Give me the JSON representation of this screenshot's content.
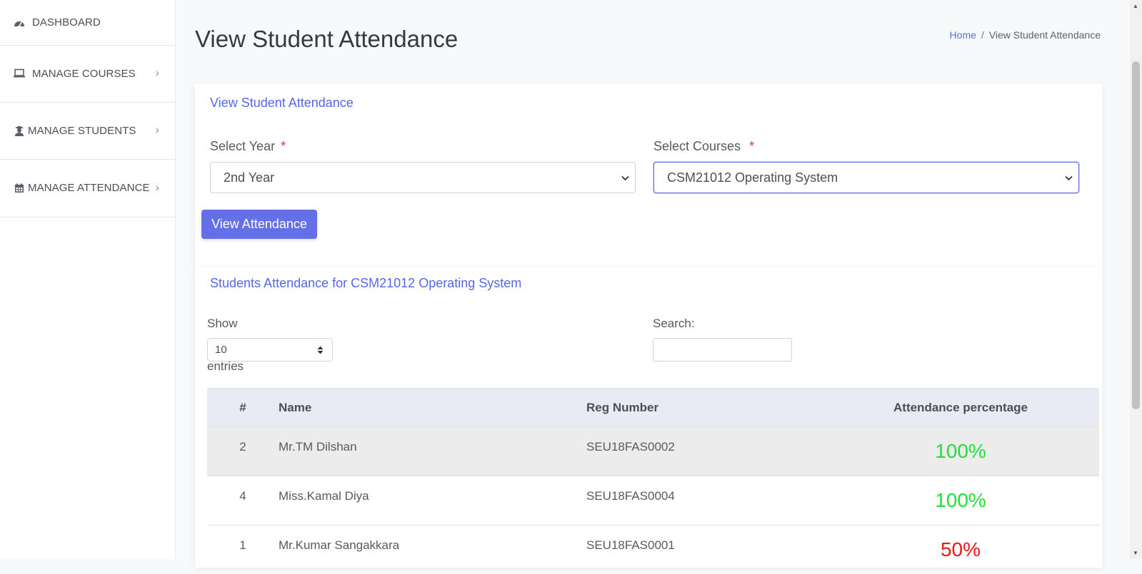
{
  "sidebar": {
    "items": [
      {
        "label": "DASHBOARD",
        "icon": "dashboard-icon",
        "has_chevron": false
      },
      {
        "label": "MANAGE COURSES",
        "icon": "laptop-icon",
        "has_chevron": true
      },
      {
        "label": "MANAGE STUDENTS",
        "icon": "student-icon",
        "has_chevron": true
      },
      {
        "label": "MANAGE ATTENDANCE",
        "icon": "calendar-icon",
        "has_chevron": true
      }
    ],
    "chevron": "›"
  },
  "page": {
    "title": "View Student Attendance",
    "breadcrumb": {
      "home": "Home",
      "separator": "/",
      "current": "View Student Attendance"
    }
  },
  "filter_card": {
    "title": "View Student Attendance",
    "year_label": "Select Year",
    "year_value": "2nd Year",
    "courses_label": "Select Courses",
    "courses_value": "CSM21012 Operating System",
    "required_mark": "*",
    "button_label": "View Attendance"
  },
  "results_card": {
    "title": "Students Attendance for CSM21012 Operating System",
    "show_label": "Show",
    "entries_value": "10",
    "entries_label": "entries",
    "search_label": "Search:",
    "search_value": "",
    "columns": [
      "#",
      "Name",
      "Reg Number",
      "Attendance percentage"
    ],
    "rows": [
      {
        "num": "2",
        "name": "Mr.TM Dilshan",
        "reg": "SEU18FAS0002",
        "pct": "100%",
        "status": "high"
      },
      {
        "num": "4",
        "name": "Miss.Kamal Diya",
        "reg": "SEU18FAS0004",
        "pct": "100%",
        "status": "high"
      },
      {
        "num": "1",
        "name": "Mr.Kumar Sangakkara",
        "reg": "SEU18FAS0001",
        "pct": "50%",
        "status": "low"
      }
    ]
  },
  "colors": {
    "accent": "#6470e8",
    "link": "#4e73df",
    "pct_high": "#22e03a",
    "pct_low": "#ef1616",
    "required": "#e53935"
  }
}
